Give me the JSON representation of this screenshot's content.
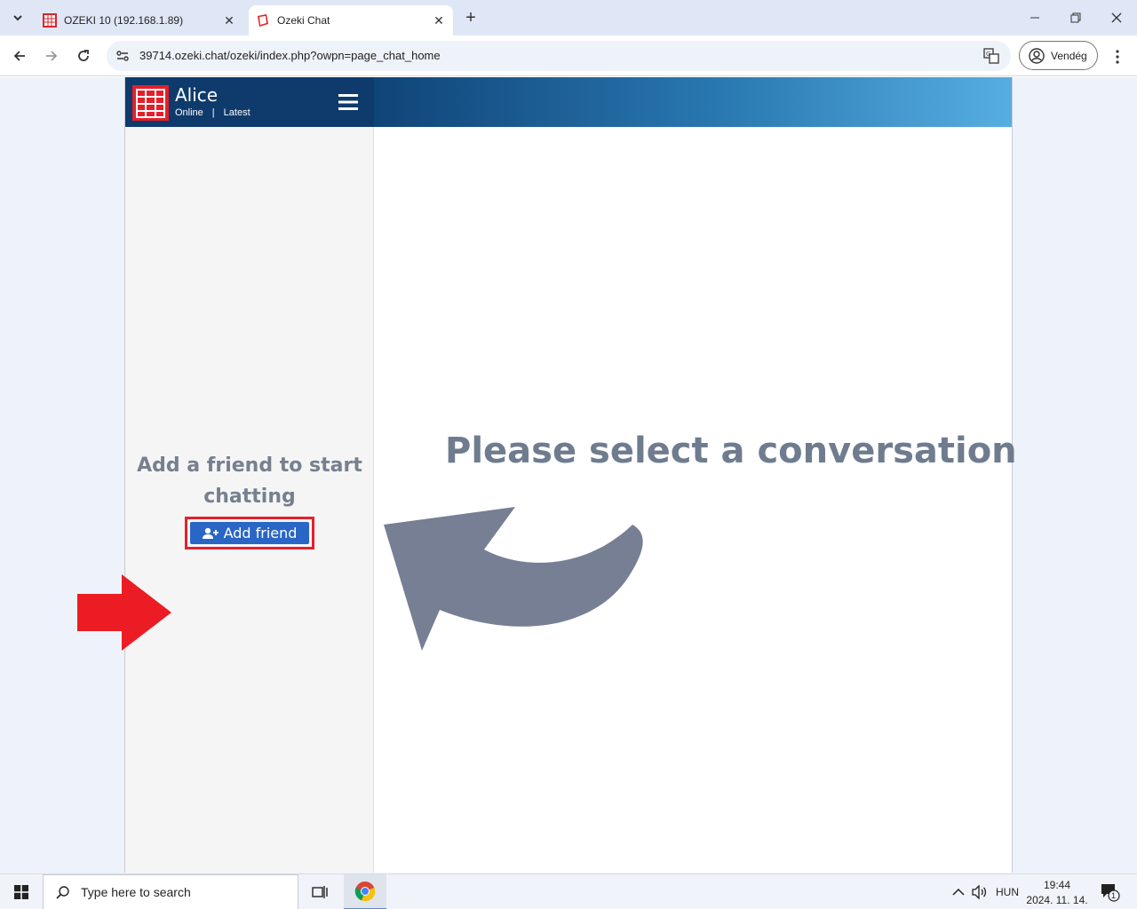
{
  "browser": {
    "tabs": [
      {
        "title": "OZEKI 10 (192.168.1.89)",
        "active": false
      },
      {
        "title": "Ozeki Chat",
        "active": true
      }
    ],
    "url": "39714.ozeki.chat/ozeki/index.php?owpn=page_chat_home",
    "profile_label": "Vendég"
  },
  "app": {
    "user": {
      "name": "Alice",
      "status": "Online",
      "separator": "|",
      "filter": "Latest"
    },
    "sidebar": {
      "empty_message": "Add a friend to start chatting",
      "add_friend_label": "Add friend"
    },
    "main": {
      "placeholder": "Please select a conversation"
    },
    "colors": {
      "header_dark": "#0e3b6c",
      "accent_blue": "#2a66c6",
      "highlight_red": "#e5202b",
      "muted_text": "#6f7c8f"
    }
  },
  "taskbar": {
    "search_placeholder": "Type here to search",
    "language": "HUN",
    "time": "19:44",
    "date": "2024. 11. 14.",
    "notification_count": "1"
  }
}
